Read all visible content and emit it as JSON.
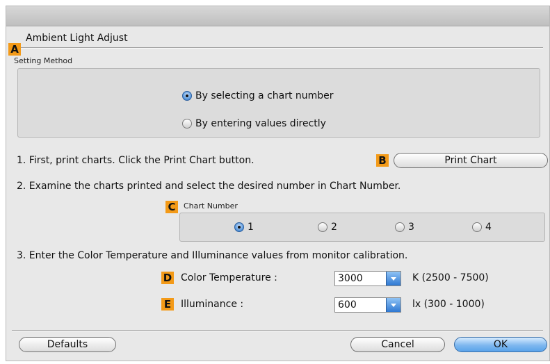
{
  "dialog": {
    "heading": "Ambient Light Adjust"
  },
  "callouts": [
    "A",
    "B",
    "C",
    "D",
    "E"
  ],
  "setting_method": {
    "label": "Setting Method",
    "options": [
      "By selecting a chart number",
      "By entering values directly"
    ],
    "selected": "By selecting a chart number"
  },
  "steps": {
    "step1": "1. First, print charts. Click the Print Chart button.",
    "step2": "2. Examine the charts printed and select the desired number in Chart Number.",
    "step3": "3. Enter the Color Temperature and Illuminance values from monitor calibration."
  },
  "print_chart_label": "Print Chart",
  "chart_number": {
    "label": "Chart Number",
    "options": [
      "1",
      "2",
      "3",
      "4"
    ],
    "selected": "1"
  },
  "color_temperature": {
    "label": "Color Temperature :",
    "value": "3000",
    "range": "K (2500 - 7500)"
  },
  "illuminance": {
    "label": "Illuminance :",
    "value": "600",
    "range": "lx (300 - 1000)"
  },
  "buttons": {
    "defaults": "Defaults",
    "cancel": "Cancel",
    "ok": "OK"
  },
  "colors": {
    "callout": "#f39a18",
    "default_button": "#7fb8ef"
  }
}
